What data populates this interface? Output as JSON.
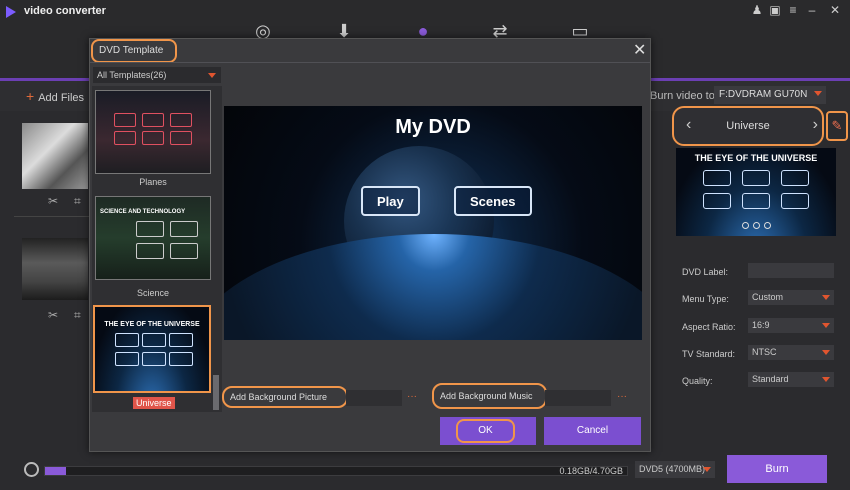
{
  "app": {
    "title": "video converter"
  },
  "nav": {
    "icons": [
      "convert-icon",
      "download-icon",
      "burn-icon",
      "transfer-icon",
      "toolbox-icon"
    ]
  },
  "window": {
    "icons": [
      "user-icon",
      "gift-icon",
      "menu-icon",
      "minimize-icon",
      "close-icon"
    ]
  },
  "toolbar": {
    "add_files": "Add Files",
    "burn_to_label": "Burn video to:",
    "burn_to_value": "F:DVDRAM GU70N"
  },
  "dialog": {
    "title": "DVD Template",
    "category": "All Templates(26)",
    "templates": [
      {
        "name": "Planes"
      },
      {
        "name": "Science",
        "heading": "SCIENCE AND TECHNOLOGY"
      },
      {
        "name": "Universe",
        "heading": "THE EYE OF THE UNIVERSE",
        "selected": true
      }
    ],
    "preview": {
      "title": "My DVD",
      "buttons": [
        "Play",
        "Scenes"
      ]
    },
    "add_picture": "Add Background Picture",
    "add_music": "Add Background Music",
    "more": "···",
    "ok": "OK",
    "cancel": "Cancel"
  },
  "right_panel": {
    "template_name": "Universe",
    "preview_title": "THE EYE OF THE UNIVERSE",
    "fields": [
      {
        "label": "DVD Label:",
        "value": ""
      },
      {
        "label": "Menu Type:",
        "value": "Custom"
      },
      {
        "label": "Aspect Ratio:",
        "value": "16:9"
      },
      {
        "label": "TV Standard:",
        "value": "NTSC"
      },
      {
        "label": "Quality:",
        "value": "Standard"
      }
    ]
  },
  "bottom": {
    "usage": "0.18GB/4.70GB",
    "progress": 0.036,
    "disc": "DVD5 (4700MB)",
    "burn": "Burn"
  },
  "colors": {
    "accent": "#8a5ad9",
    "highlight": "#f0954a"
  }
}
